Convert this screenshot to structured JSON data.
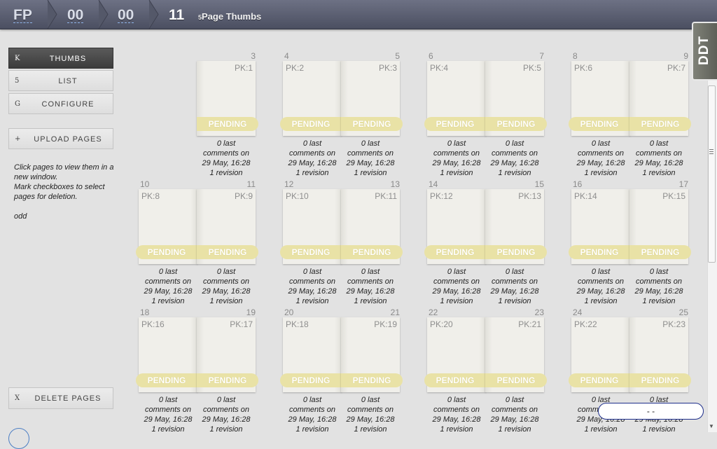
{
  "topbar": {
    "crumbs": [
      "FP",
      "00",
      "00",
      "11"
    ],
    "title_prefix": "5",
    "title": "Page Thumbs"
  },
  "sidebar": {
    "nav": [
      {
        "key": "K",
        "label": "THUMBS",
        "active": true
      },
      {
        "key": "5",
        "label": "LIST",
        "active": false
      },
      {
        "key": "G",
        "label": "CONFIGURE",
        "active": false
      }
    ],
    "upload": {
      "key": "+",
      "label": "UPLOAD PAGES"
    },
    "help": [
      "Click pages to view them in a new window.",
      "Mark checkboxes to select pages for deletion.",
      "odd"
    ],
    "delete": {
      "key": "X",
      "label": "DELETE PAGES"
    }
  },
  "thumbs": {
    "rows": [
      {
        "spreads": [
          {
            "left": null,
            "right": {
              "num": "3",
              "pk": "PK:1"
            }
          },
          {
            "left": {
              "num": "4",
              "pk": "PK:2"
            },
            "right": {
              "num": "5",
              "pk": "PK:3"
            }
          },
          {
            "left": {
              "num": "6",
              "pk": "PK:4"
            },
            "right": {
              "num": "7",
              "pk": "PK:5"
            }
          },
          {
            "left": {
              "num": "8",
              "pk": "PK:6"
            },
            "right": {
              "num": "9",
              "pk": "PK:7"
            }
          }
        ]
      },
      {
        "spreads": [
          {
            "left": {
              "num": "10",
              "pk": "PK:8"
            },
            "right": {
              "num": "11",
              "pk": "PK:9"
            }
          },
          {
            "left": {
              "num": "12",
              "pk": "PK:10"
            },
            "right": {
              "num": "13",
              "pk": "PK:11"
            }
          },
          {
            "left": {
              "num": "14",
              "pk": "PK:12"
            },
            "right": {
              "num": "15",
              "pk": "PK:13"
            }
          },
          {
            "left": {
              "num": "16",
              "pk": "PK:14"
            },
            "right": {
              "num": "17",
              "pk": "PK:15"
            }
          }
        ]
      },
      {
        "spreads": [
          {
            "left": {
              "num": "18",
              "pk": "PK:16"
            },
            "right": {
              "num": "19",
              "pk": "PK:17"
            }
          },
          {
            "left": {
              "num": "20",
              "pk": "PK:18"
            },
            "right": {
              "num": "21",
              "pk": "PK:19"
            }
          },
          {
            "left": {
              "num": "22",
              "pk": "PK:20"
            },
            "right": {
              "num": "23",
              "pk": "PK:21"
            }
          },
          {
            "left": {
              "num": "24",
              "pk": "PK:22"
            },
            "right": {
              "num": "25",
              "pk": "PK:23"
            }
          }
        ]
      }
    ],
    "status_label": "PENDING",
    "caption": [
      "0 last",
      "comments on",
      "29 May, 16:28",
      "1 revision"
    ]
  },
  "ddt_logo": "DDT",
  "floating_pill": "- -",
  "colors": {
    "topbar": "#5b5f71",
    "pending": "#e9e2a6",
    "page": "#f0efea",
    "active_button": "#444444"
  }
}
